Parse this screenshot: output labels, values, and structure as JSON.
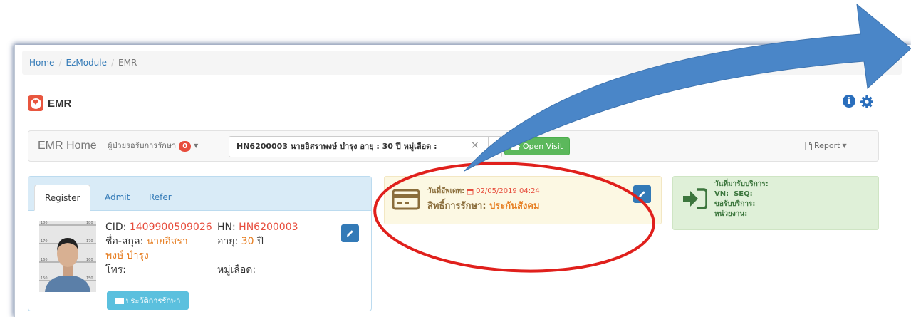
{
  "breadcrumb": {
    "items": [
      "Home",
      "EzModule",
      "EMR"
    ]
  },
  "header": {
    "title": "EMR",
    "info_icon_glyph": "i"
  },
  "navbar": {
    "brand": "EMR Home",
    "queue_label": "ผู้ป่วยรอรับการรักษา",
    "queue_count": "0",
    "search_value": "HN6200003 นายอิสราพงษ์ บำรุง อายุ : 30 ปี หมู่เลือด :",
    "clear_symbol": "×",
    "open_visit_label": "Open Visit",
    "report_label": "Report"
  },
  "patient_panel": {
    "tabs": [
      "Register",
      "Admit",
      "Refer"
    ],
    "photo_ruler": [
      "180",
      "170",
      "160",
      "150"
    ],
    "cid_label": "CID:",
    "cid_value": "1409900509026",
    "name_label": "ชื่อ-สกุล:",
    "name_value_1": "นายอิสรา",
    "name_value_2": "พงษ์ บำรุง",
    "phone_label": "โทร:",
    "phone_value": "",
    "hn_label": "HN:",
    "hn_value": "HN6200003",
    "age_label": "อายุ:",
    "age_value": "30",
    "age_unit": "ปี",
    "blood_label": "หมู่เลือด:",
    "blood_value": "",
    "history_button": "ประวัติการรักษา"
  },
  "rights_card": {
    "update_label": "วันที่อัพเดท:",
    "update_value": "02/05/2019 04:24",
    "rights_label": "สิทธิ์การรักษา:",
    "rights_value": "ประกันสังคม"
  },
  "visit_card": {
    "visit_date_label": "วันที่มารับบริการ:",
    "vn_label": "VN:",
    "seq_label": "SEQ:",
    "service_label": "ขอรับบริการ:",
    "unit_label": "หน่วยงาน:"
  },
  "colors": {
    "accent_blue": "#337ab7",
    "annotation_blue": "#4a86c8",
    "annotation_red": "#e0201c",
    "success_green": "#5cb85c",
    "danger_red": "#e74c3c",
    "orange_value": "#e67e22"
  },
  "icons": [
    "heartbeat-icon",
    "info-icon",
    "gear-icon",
    "folder-open-icon",
    "file-icon",
    "calendar-icon",
    "credit-card-icon",
    "pencil-icon",
    "sign-in-icon",
    "folder-icon"
  ]
}
